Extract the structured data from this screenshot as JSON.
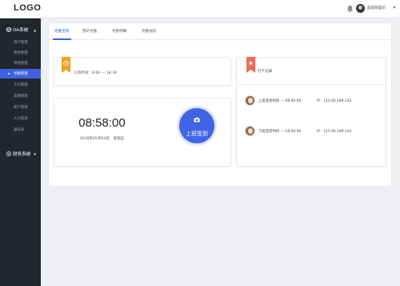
{
  "header": {
    "logo": "LOGO",
    "user_name": "超级管理员",
    "icons": [
      "bell-icon",
      "avatar",
      "chevron-down-icon"
    ]
  },
  "sidebar": {
    "groups": [
      {
        "label": "OA系统",
        "icon": "cube-icon",
        "items": [
          {
            "label": "用户管理"
          },
          {
            "label": "角色管理"
          },
          {
            "label": "审批管理"
          },
          {
            "label": "考勤管理",
            "active": true
          },
          {
            "label": "工作管理"
          },
          {
            "label": "车辆管理"
          },
          {
            "label": "客户管理"
          },
          {
            "label": "人力资源"
          },
          {
            "label": "通讯录"
          }
        ]
      },
      {
        "label": "财务系统",
        "icon": "money-icon",
        "items": []
      }
    ]
  },
  "tabs": [
    {
      "label": "考勤签到",
      "active": true
    },
    {
      "label": "我的考勤"
    },
    {
      "label": "考勤明细"
    },
    {
      "label": "考勤规则"
    }
  ],
  "work_panel": {
    "icon": "clock-icon",
    "text": "工作时间：9:00 — 18:30"
  },
  "clock_panel": {
    "time": "08:58:00",
    "date": "2018年05月04日　星期五",
    "button_label": "上班签到",
    "button_icon": "camera-icon"
  },
  "record_panel": {
    "icon": "star-icon",
    "title": "打卡记录",
    "records": [
      {
        "text": "上班签到时间 — 08:40:06",
        "ip": "IP：115.60.189.143"
      },
      {
        "text": "下班签到时间 — 18:04:06",
        "ip": "IP：115.60.189.143"
      }
    ]
  },
  "colors": {
    "accent": "#3f62e0",
    "sidebar_bg": "#23262e",
    "ribbon_orange": "#f0a020",
    "ribbon_red": "#f06a5e"
  }
}
